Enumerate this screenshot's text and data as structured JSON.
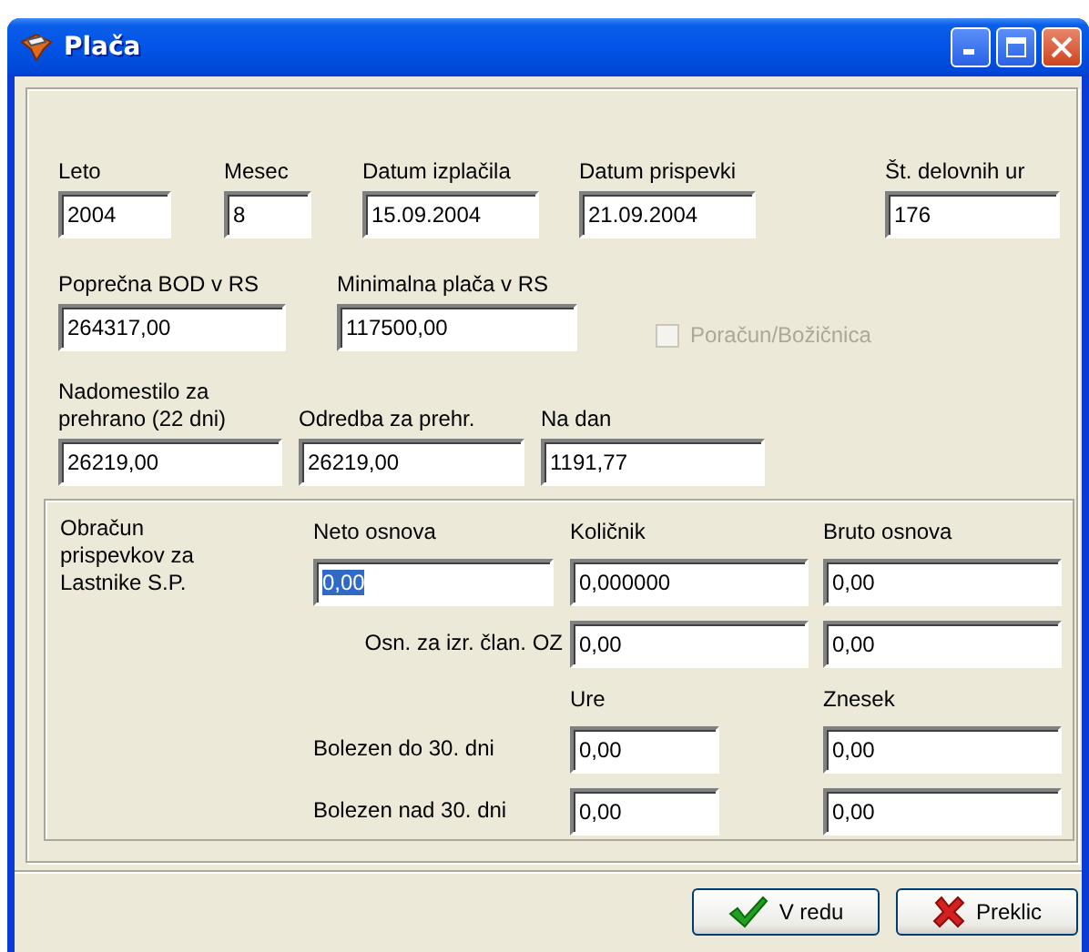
{
  "window": {
    "title": "Plača"
  },
  "title_buttons": [
    {
      "kind": "minimize"
    },
    {
      "kind": "maximize"
    },
    {
      "kind": "close"
    }
  ],
  "fields_row_1": [
    {
      "label": "Leto",
      "value": "2004"
    },
    {
      "label": "Mesec",
      "value": "8"
    },
    {
      "label": "Datum izplačila",
      "value": "15.09.2004"
    },
    {
      "label": "Datum prispevki",
      "value": "21.09.2004"
    },
    {
      "label": "Št. delovnih ur",
      "value": "176"
    }
  ],
  "fields_row_2": [
    {
      "label": "Poprečna BOD v RS",
      "value": "264317,00"
    },
    {
      "label": "Minimalna plača v RS",
      "value": "117500,00"
    }
  ],
  "checkbox": {
    "label": "Poračun/Božičnica",
    "checked": false,
    "disabled": true
  },
  "fields_row_3": [
    {
      "label": "Nadomestilo za prehrano (22 dni)",
      "value": "26219,00"
    },
    {
      "label": "Odredba za prehr.",
      "value": "26219,00"
    },
    {
      "label": "Na dan",
      "value": "1191,77"
    }
  ],
  "group": {
    "caption": "Obračun prispevkov za Lastnike S.P.",
    "rows": [
      {
        "kind": "header",
        "headers": [
          "Neto osnova",
          "Količnik",
          "Bruto osnova"
        ]
      },
      {
        "kind": "fields",
        "fields": [
          {
            "value": "0,00",
            "selected_text": true
          },
          {
            "value": "0,000000",
            "selected_text": false
          },
          {
            "value": "0,00",
            "selected_text": false
          }
        ]
      },
      {
        "kind": "fields",
        "label": "Osn. za izr. član. OZ",
        "fields": [
          {
            "value": "0,00",
            "selected_text": false
          },
          {
            "value": "0,00",
            "selected_text": false
          }
        ]
      },
      {
        "kind": "header",
        "headers": [
          "Ure",
          "Znesek"
        ]
      },
      {
        "kind": "hours",
        "label": "Bolezen do 30. dni",
        "fields": [
          {
            "value": "0,00",
            "selected_text": false
          },
          {
            "value": "0,00",
            "selected_text": false
          }
        ]
      },
      {
        "kind": "hours",
        "label": "Bolezen nad 30. dni",
        "fields": [
          {
            "value": "0,00",
            "selected_text": false
          },
          {
            "value": "0,00",
            "selected_text": false
          }
        ]
      }
    ]
  },
  "buttons": [
    {
      "kind": "ok",
      "label": "V redu"
    },
    {
      "kind": "cancel",
      "label": "Preklic"
    }
  ]
}
